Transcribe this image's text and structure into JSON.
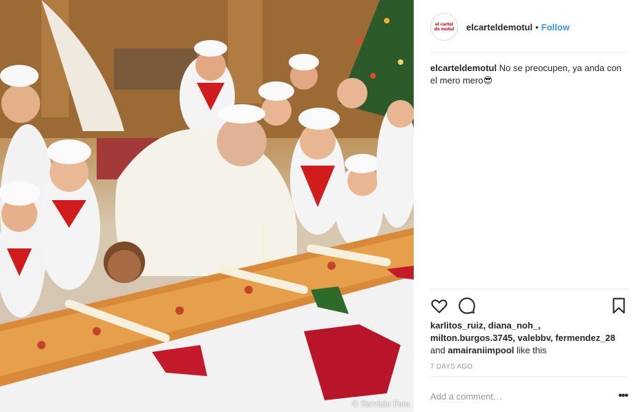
{
  "post": {
    "photo_credit": "© Servizio Foto",
    "header": {
      "username": "elcarteldemotul",
      "separator": "•",
      "follow_label": "Follow",
      "avatar_text_line1": "el cartel",
      "avatar_text_line2": "de motul"
    },
    "caption": {
      "username": "elcarteldemotul",
      "text": "No se preocupen, ya anda con el mero mero😎"
    },
    "actions": {
      "icons": [
        "heart-icon",
        "comment-icon",
        "bookmark-icon"
      ]
    },
    "likes": {
      "users": "karlitos_ruiz, diana_noh_, milton.burgos.3745, valebbv, fermendez_28",
      "and_text": "and",
      "last_user": "amairaniimpool",
      "suffix": "like this"
    },
    "date": "7 DAYS AGO",
    "comment": {
      "placeholder": "Add a comment…",
      "more_label": "•••"
    }
  },
  "colors": {
    "link": "#3897f0",
    "text": "#262626",
    "muted": "#999999",
    "divider": "#efefef"
  }
}
